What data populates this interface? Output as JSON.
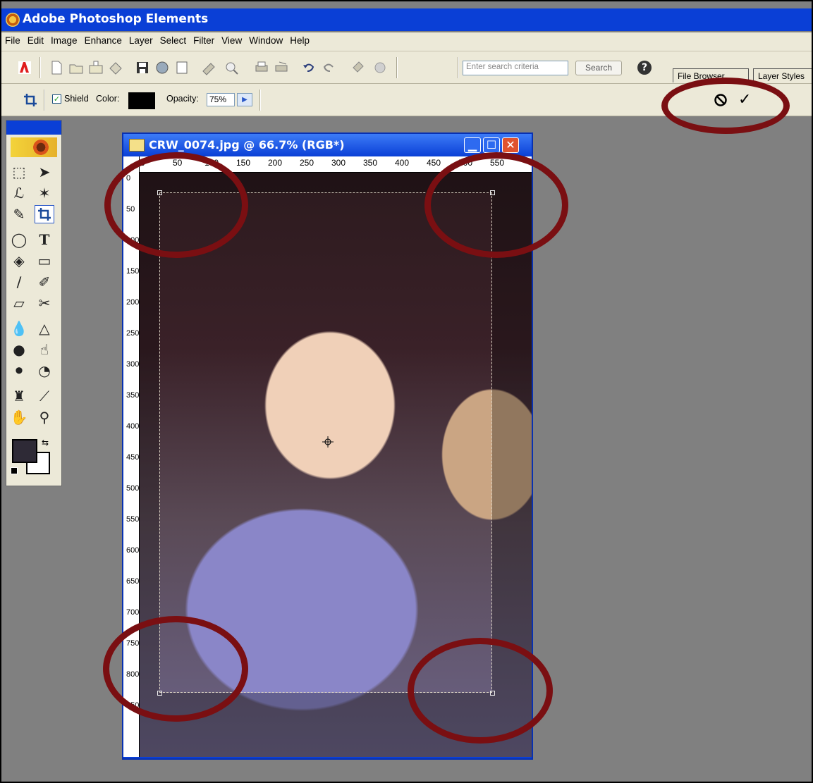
{
  "app": {
    "title": "Adobe Photoshop Elements"
  },
  "menu": [
    "File",
    "Edit",
    "Image",
    "Enhance",
    "Layer",
    "Select",
    "Filter",
    "View",
    "Window",
    "Help"
  ],
  "toolbar": {
    "search_placeholder": "Enter search criteria",
    "search_button": "Search",
    "palette_tabs": [
      "File Browser",
      "Layer Styles"
    ]
  },
  "options": {
    "shield_label": "Shield",
    "shield_checked": true,
    "color_label": "Color:",
    "color_value": "#000000",
    "opacity_label": "Opacity:",
    "opacity_value": "75%"
  },
  "document": {
    "title": "CRW_0074.jpg @ 66.7% (RGB*)",
    "ruler_h": [
      "0",
      "50",
      "100",
      "150",
      "200",
      "250",
      "300",
      "350",
      "400",
      "450",
      "500",
      "550"
    ],
    "ruler_v": [
      "0",
      "50",
      "100",
      "150",
      "200",
      "250",
      "300",
      "350",
      "400",
      "450",
      "500",
      "550",
      "600",
      "650",
      "700",
      "750",
      "800",
      "850"
    ]
  },
  "colors": {
    "annotation": "#7a0f12",
    "titlebar": "#0a3fd6",
    "foreground": "#2e2a36",
    "background": "#ffffff"
  },
  "icons": {
    "cancel": "cancel-crop-icon",
    "commit": "commit-crop-icon"
  }
}
